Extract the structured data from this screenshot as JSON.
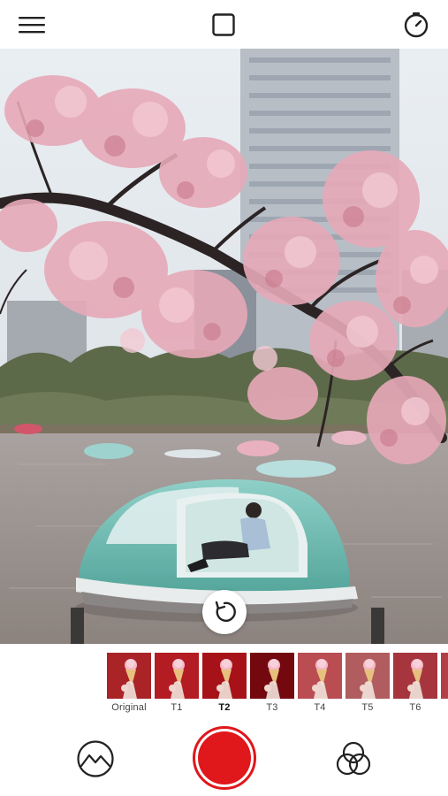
{
  "topbar": {
    "menu_icon": "hamburger-menu-icon",
    "aspect_icon": "square-aspect-icon",
    "timer_icon": "timer-icon"
  },
  "photo": {
    "subject": "photo-preview",
    "rotate_icon": "rotate-icon"
  },
  "filters": {
    "selected": "T2",
    "items": [
      {
        "label": "Original",
        "tint": "#b8262b"
      },
      {
        "label": "T1",
        "tint": "#c41f26"
      },
      {
        "label": "T2",
        "tint": "#b5141b"
      },
      {
        "label": "T3",
        "tint": "#7d0a10"
      },
      {
        "label": "T4",
        "tint": "#c9545a"
      },
      {
        "label": "T5",
        "tint": "#c06468"
      },
      {
        "label": "T6",
        "tint": "#b53a44"
      },
      {
        "label": "",
        "tint": "#c2454d"
      }
    ]
  },
  "bottom": {
    "gallery_icon": "gallery-mountain-icon",
    "shutter_color": "#e0171b",
    "effects_icon": "color-effects-icon"
  }
}
